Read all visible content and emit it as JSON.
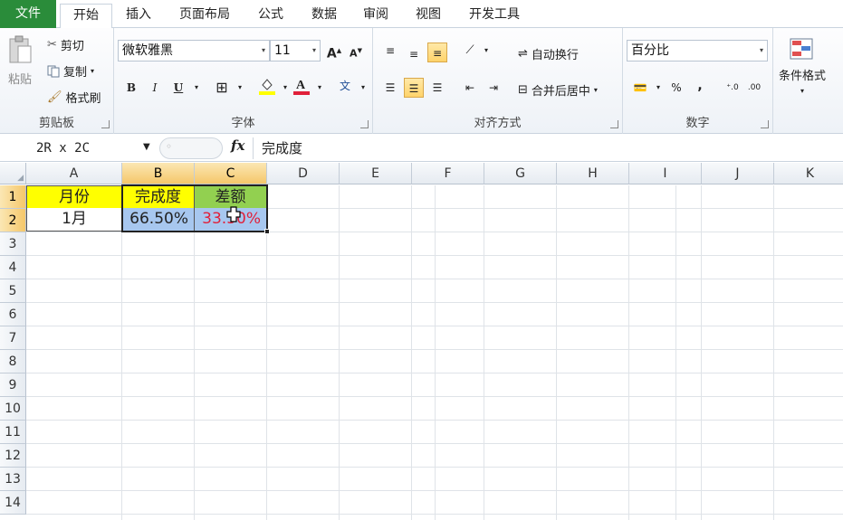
{
  "tabs": [
    "文件",
    "开始",
    "插入",
    "页面布局",
    "公式",
    "数据",
    "审阅",
    "视图",
    "开发工具"
  ],
  "clipboard": {
    "paste": "粘贴",
    "cut": "剪切",
    "copy": "复制",
    "format_painter": "格式刷",
    "label": "剪贴板"
  },
  "font": {
    "name": "微软雅黑",
    "size": "11",
    "bold": "B",
    "italic": "I",
    "underline": "U",
    "label": "字体"
  },
  "alignment": {
    "wrap_text": "自动换行",
    "merge_center": "合并后居中",
    "label": "对齐方式"
  },
  "number": {
    "format": "百分比",
    "percent": "%",
    "comma": ",",
    "label": "数字"
  },
  "styles": {
    "conditional_format": "条件格式"
  },
  "formula_bar": {
    "name_box": "2R x 2C",
    "fx": "fx",
    "formula": "完成度"
  },
  "columns": [
    "A",
    "B",
    "C",
    "D",
    "E",
    "F",
    "G",
    "H",
    "I",
    "J",
    "K"
  ],
  "rows": [
    "1",
    "2",
    "3",
    "4",
    "5",
    "6",
    "7",
    "8",
    "9",
    "10",
    "11",
    "12",
    "13",
    "14"
  ],
  "cells": {
    "A1": "月份",
    "B1": "完成度",
    "C1": "差额",
    "A2": "1月",
    "B2": "66.50%",
    "C2": "33.50%"
  },
  "colors": {
    "file_tab": "#2a8c3a",
    "header_yellow": "#ffff00",
    "header_green": "#92d050",
    "selection": "#a7c7ef",
    "negative_red": "#e0203a"
  }
}
